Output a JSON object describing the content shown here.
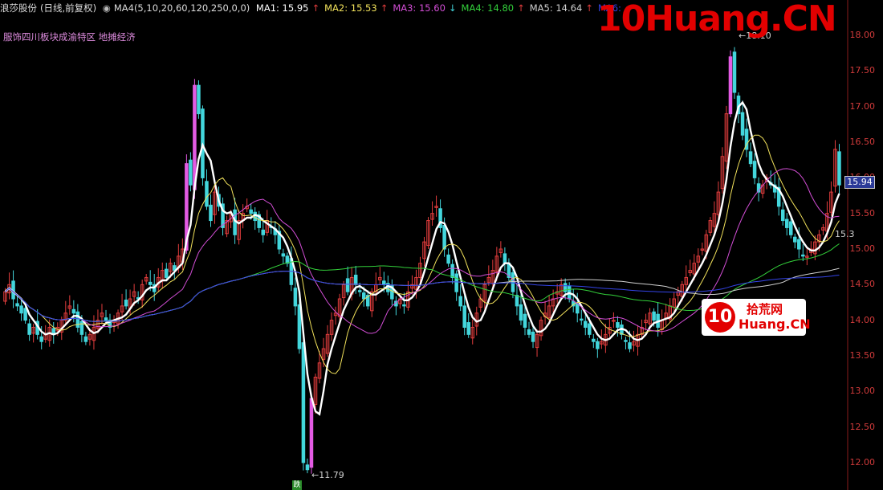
{
  "header": {
    "stock": "浪莎股份",
    "period": "(日线,前复权)",
    "ma_group": "MA4(5,10,20,60,120,250,0,0)",
    "ma_values": [
      {
        "label": "MA1: 15.95",
        "arrow": "↑",
        "color": "#ffffff"
      },
      {
        "label": "MA2: 15.53",
        "arrow": "↑",
        "color": "#f1e15b"
      },
      {
        "label": "MA3: 15.60",
        "arrow": "↓",
        "color": "#d34ed6"
      },
      {
        "label": "MA4: 14.80",
        "arrow": "↑",
        "color": "#33d13b"
      },
      {
        "label": "MA5: 14.64",
        "arrow": "↑",
        "color": "#d0d0d0"
      },
      {
        "label": "MA6:",
        "arrow": "",
        "color": "#3444e8"
      }
    ]
  },
  "tags": "服饰四川板块成渝特区  地摊经济",
  "price_axis": [
    "18.00",
    "17.50",
    "17.00",
    "16.50",
    "16.00",
    "15.50",
    "15.00",
    "14.50",
    "14.00",
    "13.50",
    "13.00",
    "12.50",
    "12.00"
  ],
  "current_price": "15.94",
  "annotations": {
    "low": "11.79",
    "high": "18.10",
    "side": "15.3",
    "bottom_badge": "跌"
  },
  "watermark": {
    "main": "10Huang.CN",
    "logo_num": "10",
    "logo_cn": "拾荒网",
    "logo_url": "Huang.CN"
  },
  "colors": {
    "up": "#e23d3d",
    "down": "#43d6dc",
    "limit": "#e35be3",
    "bg": "#000000"
  },
  "chart_data": {
    "type": "candlestick",
    "ylim": [
      11.75,
      18.25
    ],
    "count": 210,
    "close": [
      14.4,
      14.5,
      14.3,
      14.2,
      14.1,
      14.0,
      13.8,
      13.9,
      13.8,
      13.7,
      13.8,
      13.9,
      13.8,
      13.9,
      14.0,
      14.1,
      14.2,
      14.1,
      13.9,
      13.8,
      13.7,
      13.8,
      13.9,
      14.0,
      14.1,
      14.0,
      13.9,
      14.0,
      14.1,
      14.2,
      14.2,
      14.3,
      14.4,
      14.3,
      14.5,
      14.6,
      14.5,
      14.4,
      14.6,
      14.7,
      14.6,
      14.8,
      14.7,
      14.9,
      15.0,
      16.2,
      15.9,
      17.3,
      16.9,
      16.0,
      15.6,
      15.4,
      15.8,
      15.6,
      15.3,
      15.4,
      15.5,
      15.2,
      15.4,
      15.5,
      15.6,
      15.5,
      15.4,
      15.3,
      15.2,
      15.4,
      15.3,
      15.2,
      15.0,
      14.9,
      14.8,
      14.5,
      14.2,
      13.6,
      12.0,
      11.9,
      12.9,
      13.2,
      13.4,
      13.6,
      13.8,
      14.0,
      14.1,
      14.3,
      14.5,
      14.4,
      14.6,
      14.5,
      14.4,
      14.3,
      14.2,
      14.4,
      14.5,
      14.6,
      14.5,
      14.4,
      14.3,
      14.2,
      14.3,
      14.2,
      14.4,
      14.5,
      14.6,
      14.8,
      15.1,
      15.4,
      15.5,
      15.6,
      15.3,
      15.0,
      14.8,
      14.6,
      14.4,
      14.2,
      13.9,
      13.8,
      13.9,
      14.1,
      14.3,
      14.5,
      14.6,
      14.7,
      14.9,
      15.0,
      14.8,
      14.6,
      14.4,
      14.2,
      14.0,
      13.9,
      13.8,
      13.7,
      13.8,
      14.0,
      14.1,
      14.2,
      14.3,
      14.4,
      14.5,
      14.4,
      14.3,
      14.2,
      14.1,
      14.0,
      13.9,
      13.8,
      13.7,
      13.6,
      13.7,
      13.8,
      13.9,
      14.0,
      13.9,
      13.8,
      13.7,
      13.6,
      13.7,
      13.8,
      13.9,
      14.0,
      14.1,
      14.0,
      13.9,
      14.0,
      14.1,
      14.2,
      14.3,
      14.4,
      14.5,
      14.6,
      14.7,
      14.8,
      14.9,
      15.0,
      15.2,
      15.4,
      15.5,
      15.8,
      16.3,
      16.9,
      17.7,
      17.2,
      16.9,
      16.6,
      16.4,
      16.2,
      16.0,
      15.8,
      15.9,
      16.0,
      15.9,
      15.8,
      15.6,
      15.4,
      15.3,
      15.2,
      15.1,
      15.0,
      14.9,
      14.9,
      15.0,
      15.1,
      15.2,
      15.3,
      15.5,
      15.8,
      16.4,
      15.9
    ]
  }
}
